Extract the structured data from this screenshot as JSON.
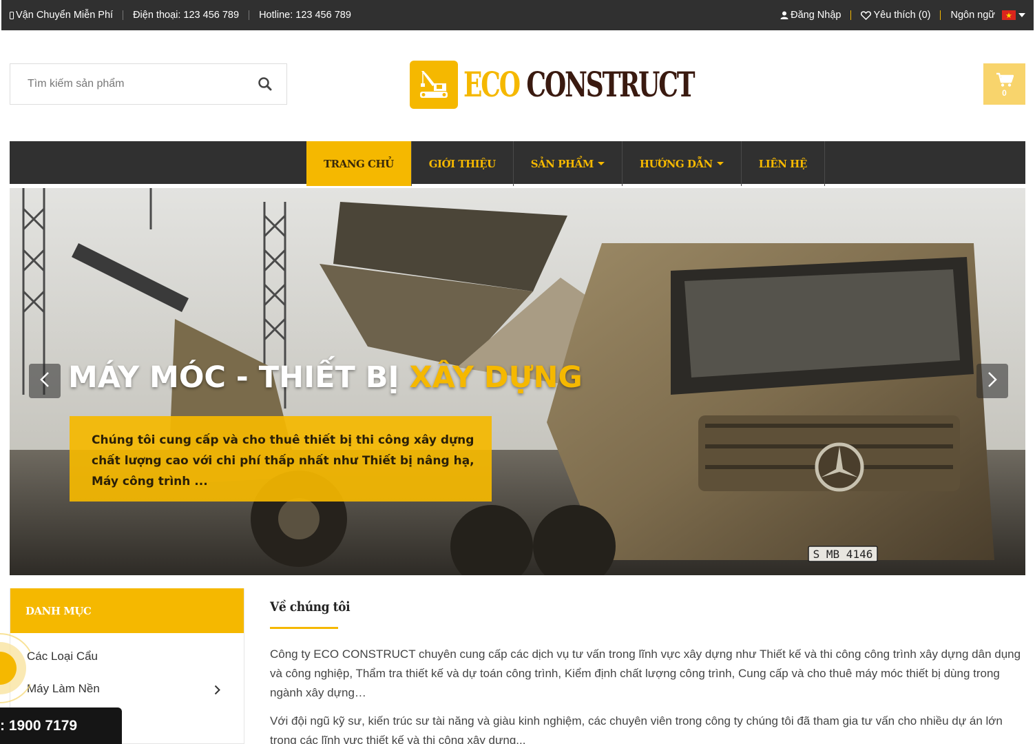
{
  "topbar": {
    "shipping": "Vận Chuyển Miễn Phí",
    "phone": "Điện thoại: 123 456 789",
    "hotline": "Hotline: 123 456 789",
    "login": "Đăng Nhập",
    "wishlist": "Yêu thích (0)",
    "language_label": "Ngôn ngữ"
  },
  "search": {
    "placeholder": "Tìm kiếm sản phẩm"
  },
  "logo": {
    "eco": "ECO",
    "construct": "CONSTRUCT"
  },
  "cart": {
    "count": "0"
  },
  "nav": {
    "items": [
      {
        "label": "TRANG CHỦ",
        "active": true
      },
      {
        "label": "GIỚI THIỆU"
      },
      {
        "label": "SẢN PHẨM",
        "dropdown": true
      },
      {
        "label": "HƯỚNG DẪN",
        "dropdown": true
      },
      {
        "label": "LIÊN HỆ"
      }
    ]
  },
  "hero": {
    "title_main": "MÁY MÓC - THIẾT BỊ ",
    "title_highlight": "XÂY DỰNG",
    "caption": "Chúng tôi  cung cấp và cho thuê thiết bị thi công xây dựng chất lượng cao với chi phí thấp nhất như Thiết bị nâng hạ, Máy công trình ...",
    "plate": "S MB 4146"
  },
  "sidebar": {
    "title": "DANH MỤC",
    "items": [
      {
        "label": "Các Loại Cẩu"
      },
      {
        "label": "Máy Làm Nền"
      }
    ]
  },
  "about": {
    "heading": "Về chúng tôi",
    "p1": "Công ty ECO CONSTRUCT chuyên cung cấp các dịch vụ tư vấn trong lĩnh vực xây dựng như Thiết kế và thi công công trình xây dựng dân dụng và công nghiệp, Thẩm tra thiết kế và dự toán công trình, Kiểm định chất lượng công trình, Cung cấp và cho thuê máy móc thiết bị dùng trong ngành xây dựng…",
    "p2": "Với đội ngũ kỹ sư, kiến trúc sư tài năng và giàu kinh nghiệm, các chuyên viên trong công ty chúng tôi đã tham gia tư vấn cho nhiều dự án lớn trong các lĩnh vực thiết kế và thi công xây dựng..."
  },
  "hotline_float": {
    "number": ": 1900 7179"
  },
  "colors": {
    "accent": "#f5b800",
    "dark": "#303030",
    "logo_dark": "#3a1a10"
  }
}
